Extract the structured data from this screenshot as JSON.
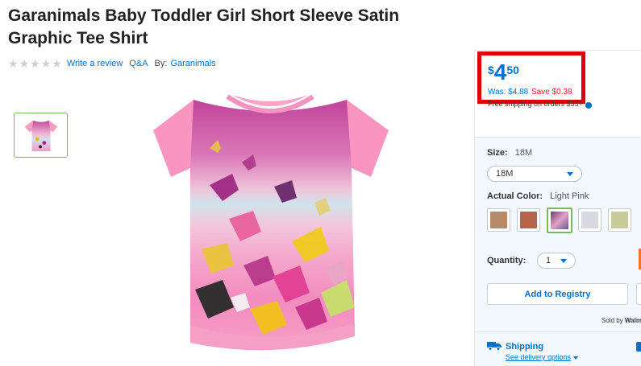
{
  "product": {
    "title": "Garanimals Baby Toddler Girl Short Sleeve Satin Graphic Tee Shirt",
    "rating_stars_filled": 0,
    "rating_stars_total": 5,
    "write_review_label": "Write a review",
    "qa_label": "Q&A",
    "by_label": "By:",
    "brand": "Garanimals"
  },
  "price": {
    "currency": "$",
    "dollars": "4",
    "cents": "50",
    "was": "Was: $4.88",
    "save": "Save $0.38"
  },
  "shipping_note": "Free shipping on orders $35+",
  "size": {
    "label": "Size:",
    "value": "18M",
    "selected": "18M"
  },
  "color": {
    "label": "Actual Color:",
    "value": "Light Pink",
    "swatch_colors": [
      "#b58a6a",
      "#b8644a",
      "#9a6a88",
      "#d8d8e0",
      "#c8cc9a"
    ],
    "selected_index": 2
  },
  "quantity": {
    "label": "Quantity:",
    "selected": "1"
  },
  "buttons": {
    "registry": "Add to Registry"
  },
  "sold_by": {
    "prefix": "Sold by",
    "seller": "Walm"
  },
  "shipping": {
    "title": "Shipping",
    "options_link": "See delivery options"
  },
  "colors": {
    "accent_blue": "#0071ce",
    "highlight_red": "#e0000a",
    "save_red": "#de1c24",
    "selected_green": "#7bb661"
  }
}
